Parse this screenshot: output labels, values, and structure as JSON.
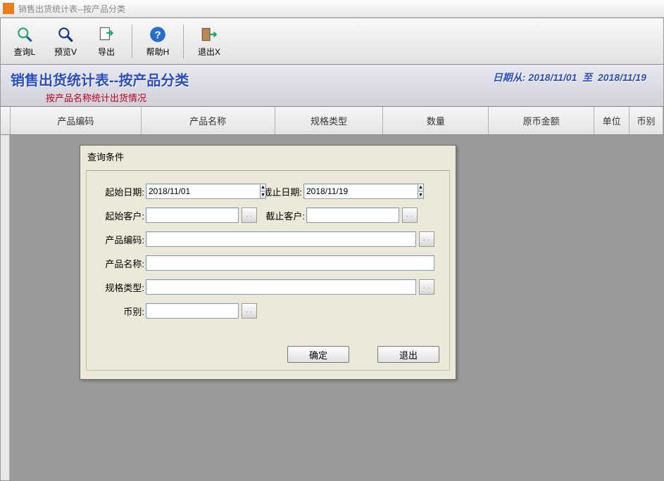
{
  "window": {
    "title": "销售出货统计表--按产品分类"
  },
  "toolbar": {
    "query": "查询L",
    "preview": "预览V",
    "export": "导出",
    "help": "帮助H",
    "exit": "退出X"
  },
  "banner": {
    "title": "销售出货统计表--按产品分类",
    "subtitle": "按产品名称统计出货情况",
    "date_label_from": "日期从:",
    "date_from": "2018/11/01",
    "date_label_to": "至",
    "date_to": "2018/11/19"
  },
  "columns": [
    {
      "label": "",
      "width": 14
    },
    {
      "label": "产品编码",
      "width": 186
    },
    {
      "label": "产品名称",
      "width": 190
    },
    {
      "label": "规格类型",
      "width": 154
    },
    {
      "label": "数量",
      "width": 150
    },
    {
      "label": "原币金额",
      "width": 150
    },
    {
      "label": "单位",
      "width": 50
    },
    {
      "label": "币别",
      "width": 48
    }
  ],
  "dialog": {
    "title": "查询条件",
    "labels": {
      "start_date": "起始日期:",
      "end_date": "截止日期:",
      "start_cust": "起始客户:",
      "end_cust": "截止客户:",
      "prod_code": "产品编码:",
      "prod_name": "产品名称:",
      "spec": "规格类型:",
      "currency": "币别:"
    },
    "values": {
      "start_date": "2018/11/01",
      "end_date": "2018/11/19",
      "start_cust": "",
      "end_cust": "",
      "prod_code": "",
      "prod_name": "",
      "spec": "",
      "currency": ""
    },
    "buttons": {
      "ok": "确定",
      "cancel": "退出"
    }
  }
}
